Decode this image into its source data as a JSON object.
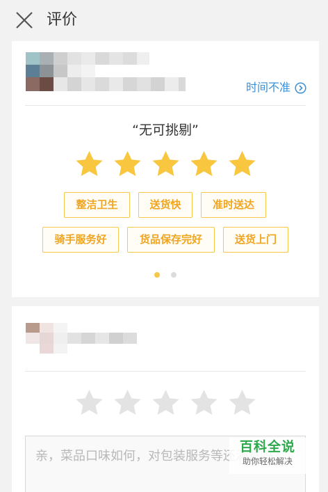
{
  "header": {
    "title": "评价",
    "close_icon": "close-icon"
  },
  "delivery_card": {
    "time_link_label": "时间不准",
    "rating_text": "“无可挑剔”",
    "rating": 5,
    "max_rating": 5,
    "tags": [
      "整洁卫生",
      "送货快",
      "准时送达",
      "骑手服务好",
      "货品保存完好",
      "送货上门"
    ],
    "pages_total": 2,
    "page_active": 1
  },
  "store_card": {
    "rating": 0,
    "max_rating": 5,
    "comment_placeholder": "亲，菜品口味如何，对包装服务等还满意吗？"
  },
  "watermark": {
    "title": "百科全说",
    "subtitle": "助你轻松解决"
  },
  "colors": {
    "accent": "#3a90d8",
    "star_active": "#f8c63f",
    "star_inactive": "#e3e3e3",
    "tag_text": "#f0a522"
  }
}
